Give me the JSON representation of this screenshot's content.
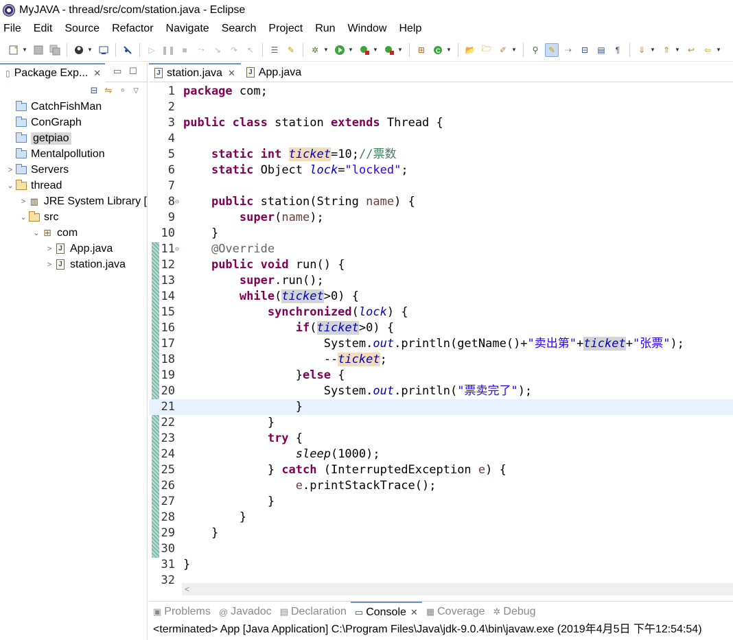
{
  "window": {
    "title": "MyJAVA - thread/src/com/station.java - Eclipse"
  },
  "menu": [
    "File",
    "Edit",
    "Source",
    "Refactor",
    "Navigate",
    "Search",
    "Project",
    "Run",
    "Window",
    "Help"
  ],
  "package_explorer": {
    "tab_label": "Package Exp...",
    "items": [
      {
        "label": "CatchFishMan"
      },
      {
        "label": "ConGraph"
      },
      {
        "label": "getpiao"
      },
      {
        "label": "Mentalpollution"
      },
      {
        "label": "Servers"
      },
      {
        "label": "thread"
      },
      {
        "label": "JRE System Library ["
      },
      {
        "label": "src"
      },
      {
        "label": "com"
      },
      {
        "label": "App.java"
      },
      {
        "label": "station.java"
      }
    ]
  },
  "editor": {
    "tabs": [
      {
        "label": "station.java"
      },
      {
        "label": "App.java"
      }
    ],
    "line_numbers": [
      "1",
      "2",
      "3",
      "4",
      "5",
      "6",
      "7",
      "8",
      "9",
      "10",
      "11",
      "12",
      "13",
      "14",
      "15",
      "16",
      "17",
      "18",
      "19",
      "20",
      "21",
      "22",
      "23",
      "24",
      "25",
      "26",
      "27",
      "28",
      "29",
      "30",
      "31",
      "32"
    ],
    "code": {
      "l1_kw": "package",
      "l1_rest": " com;",
      "l3_kw1": "public",
      "l3_kw2": "class",
      "l3_name": " station ",
      "l3_kw3": "extends",
      "l3_rest": " Thread {",
      "l5_kw1": "static",
      "l5_kw2": "int",
      "l5_fld": "ticket",
      "l5_rest": "=10;",
      "l5_cm": "//票数",
      "l6_kw": "static",
      "l6_type": " Object ",
      "l6_fld": "lock",
      "l6_eq": "=",
      "l6_str": "\"locked\"",
      "l6_end": ";",
      "l8_kw": "public",
      "l8_name": " station(String ",
      "l8_param": "name",
      "l8_end": ") {",
      "l9_kw": "super",
      "l9_open": "(",
      "l9_param": "name",
      "l9_end": ");",
      "l10": "}",
      "l11_ann": "@Override",
      "l12_kw1": "public",
      "l12_kw2": "void",
      "l12_rest": " run() {",
      "l13_kw": "super",
      "l13_rest": ".run();",
      "l14_kw": "while",
      "l14_open": "(",
      "l14_fld": "ticket",
      "l14_rest": ">0) {",
      "l15_kw": "synchronized",
      "l15_open": "(",
      "l15_fld": "lock",
      "l15_end": ") {",
      "l16_kw": "if",
      "l16_open": "(",
      "l16_fld": "ticket",
      "l16_rest": ">0) {",
      "l17_a": "System.",
      "l17_out": "out",
      "l17_b": ".println(getName()+",
      "l17_s1": "\"卖出第\"",
      "l17_plus1": "+",
      "l17_fld": "ticket",
      "l17_plus2": "+",
      "l17_s2": "\"张票\"",
      "l17_end": ");",
      "l18_a": "--",
      "l18_fld": "ticket",
      "l18_end": ";",
      "l19_a": "}",
      "l19_kw": "else",
      "l19_end": " {",
      "l20_a": "System.",
      "l20_out": "out",
      "l20_b": ".println(",
      "l20_s": "\"票卖完了\"",
      "l20_end": ");",
      "l21": "}",
      "l22": "}",
      "l23_kw": "try",
      "l23_end": " {",
      "l24_m": "sleep",
      "l24_end": "(1000);",
      "l25_a": "} ",
      "l25_kw": "catch",
      "l25_b": " (InterruptedException ",
      "l25_param": "e",
      "l25_end": ") {",
      "l26_param": "e",
      "l26_rest": ".printStackTrace();",
      "l27": "}",
      "l28": "}",
      "l29": "}",
      "l31": "}"
    },
    "hscroll_arrow": "<"
  },
  "bottom_panel": {
    "tabs": [
      {
        "label": "Problems"
      },
      {
        "label": "Javadoc"
      },
      {
        "label": "Declaration"
      },
      {
        "label": "Console"
      },
      {
        "label": "Coverage"
      },
      {
        "label": "Debug"
      }
    ],
    "console_text": "<terminated> App [Java Application] C:\\Program Files\\Java\\jdk-9.0.4\\bin\\javaw.exe (2019年4月5日 下午12:54:54)"
  }
}
